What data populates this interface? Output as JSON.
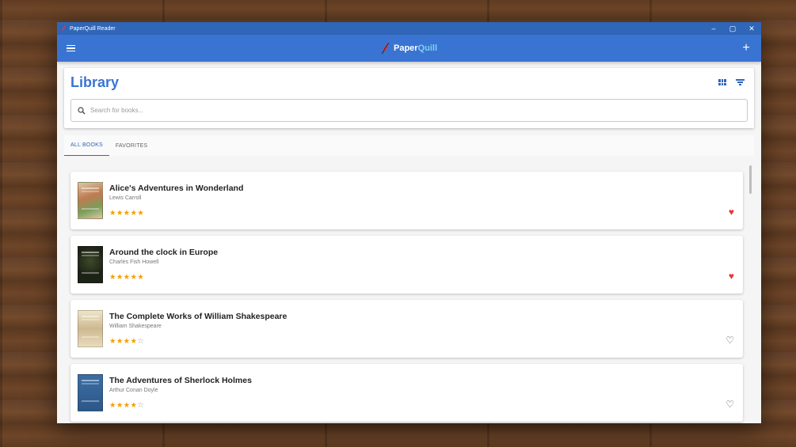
{
  "window": {
    "title": "PaperQuill Reader"
  },
  "appbar": {
    "brand_first": "Paper",
    "brand_second": "Quill"
  },
  "header": {
    "title": "Library"
  },
  "search": {
    "placeholder": "Search for books..."
  },
  "tabs": [
    {
      "label": "ALL BOOKS",
      "active": true
    },
    {
      "label": "FAVORITES",
      "active": false
    }
  ],
  "books": [
    {
      "title": "Alice's Adventures in Wonderland",
      "author": "Lewis Carroll",
      "rating": 5,
      "stars_on": "★★★★★",
      "stars_off": "",
      "favorite": true,
      "fav_glyph": "♥"
    },
    {
      "title": "Around the clock in Europe",
      "author": "Charles Fish Howell",
      "rating": 5,
      "stars_on": "★★★★★",
      "stars_off": "",
      "favorite": true,
      "fav_glyph": "♥"
    },
    {
      "title": "The Complete Works of William Shakespeare",
      "author": "William Shakespeare",
      "rating": 4,
      "stars_on": "★★★★",
      "stars_off": "☆",
      "favorite": false,
      "fav_glyph": "♡"
    },
    {
      "title": "The Adventures of Sherlock Holmes",
      "author": "Arthur Conan Doyle",
      "rating": 4,
      "stars_on": "★★★★",
      "stars_off": "☆",
      "favorite": false,
      "fav_glyph": "♡"
    }
  ],
  "colors": {
    "accent": "#3a74d3",
    "titlebar": "#2f66b8",
    "star": "#f4a000",
    "favorite": "#e53935"
  },
  "icons": {
    "menu": "menu-icon",
    "add": "add-icon",
    "grid": "grid-view-icon",
    "filter": "filter-icon",
    "search": "search-icon"
  }
}
